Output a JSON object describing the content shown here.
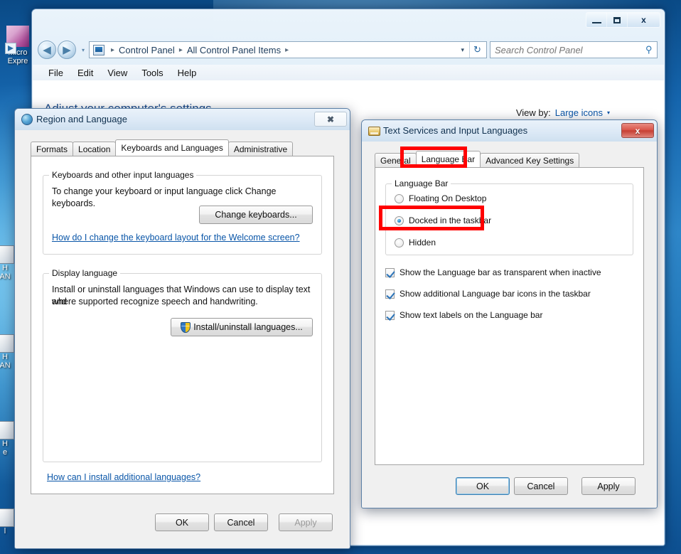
{
  "desktop": {
    "icons": [
      {
        "name": "Micro\nExpre",
        "label_line1": "Micro",
        "label_line2": "Expre"
      },
      {
        "label_line1": "H",
        "label_line2": "AN"
      },
      {
        "label_line1": "H",
        "label_line2": "AN"
      },
      {
        "label_line1": "H",
        "label_line2": "e"
      },
      {
        "label_line1": "l",
        "label_line2": ""
      }
    ]
  },
  "control_panel": {
    "window_title": "",
    "caption_buttons": {
      "minimize": "–",
      "maximize": "□",
      "close": "x"
    },
    "nav": {
      "back": "◀",
      "forward": "▶",
      "recent_caret": "▾"
    },
    "address": {
      "crumbs": [
        "Control Panel",
        "All Control Panel Items"
      ],
      "separator": "▸",
      "dropdown_caret": "▾",
      "refresh_icon": "↻"
    },
    "search": {
      "placeholder": "Search Control Panel",
      "value": "",
      "icon": "search-icon"
    },
    "menu": [
      "File",
      "Edit",
      "View",
      "Tools",
      "Help"
    ],
    "heading": "Adjust your computer's settings",
    "view_by": {
      "label": "View by:",
      "value": "Large icons",
      "caret": "▾"
    }
  },
  "region_dialog": {
    "title": "Region and Language",
    "close_label": "✖",
    "tabs": [
      {
        "label": "Formats",
        "active": false
      },
      {
        "label": "Location",
        "active": false
      },
      {
        "label": "Keyboards and Languages",
        "active": true
      },
      {
        "label": "Administrative",
        "active": false
      }
    ],
    "keyboards_group": {
      "title": "Keyboards and other input languages",
      "description": "To change your keyboard or input language click Change keyboards.",
      "button": "Change keyboards...",
      "link": "How do I change the keyboard layout for the Welcome screen?"
    },
    "display_language_group": {
      "title": "Display language",
      "description_line1": "Install or uninstall languages that Windows can use to display text and",
      "description_line2": "where supported recognize speech and handwriting.",
      "button": "Install/uninstall languages...",
      "button_icon": "shield-icon"
    },
    "bottom_link": "How can I install additional languages?",
    "buttons": {
      "ok": "OK",
      "cancel": "Cancel",
      "apply": "Apply",
      "apply_disabled": true
    }
  },
  "text_services_dialog": {
    "title": "Text Services and Input Languages",
    "close_label": "x",
    "tabs": [
      {
        "label": "General",
        "active": false
      },
      {
        "label": "Language Bar",
        "active": true
      },
      {
        "label": "Advanced Key Settings",
        "active": false
      }
    ],
    "language_bar_group": {
      "title": "Language Bar",
      "options": [
        {
          "label": "Floating On Desktop",
          "selected": false
        },
        {
          "label": "Docked in the taskbar",
          "selected": true
        },
        {
          "label": "Hidden",
          "selected": false
        }
      ]
    },
    "checkboxes": [
      {
        "label": "Show the Language bar as transparent when inactive",
        "checked": true
      },
      {
        "label": "Show additional Language bar icons in the taskbar",
        "checked": true
      },
      {
        "label": "Show text labels on the Language bar",
        "checked": true
      }
    ],
    "buttons": {
      "ok": "OK",
      "cancel": "Cancel",
      "apply": "Apply",
      "ok_focused": true
    }
  },
  "annotations": {
    "color": "#ff0000",
    "boxes": [
      "language-bar-tab",
      "docked-in-the-taskbar-option"
    ]
  }
}
